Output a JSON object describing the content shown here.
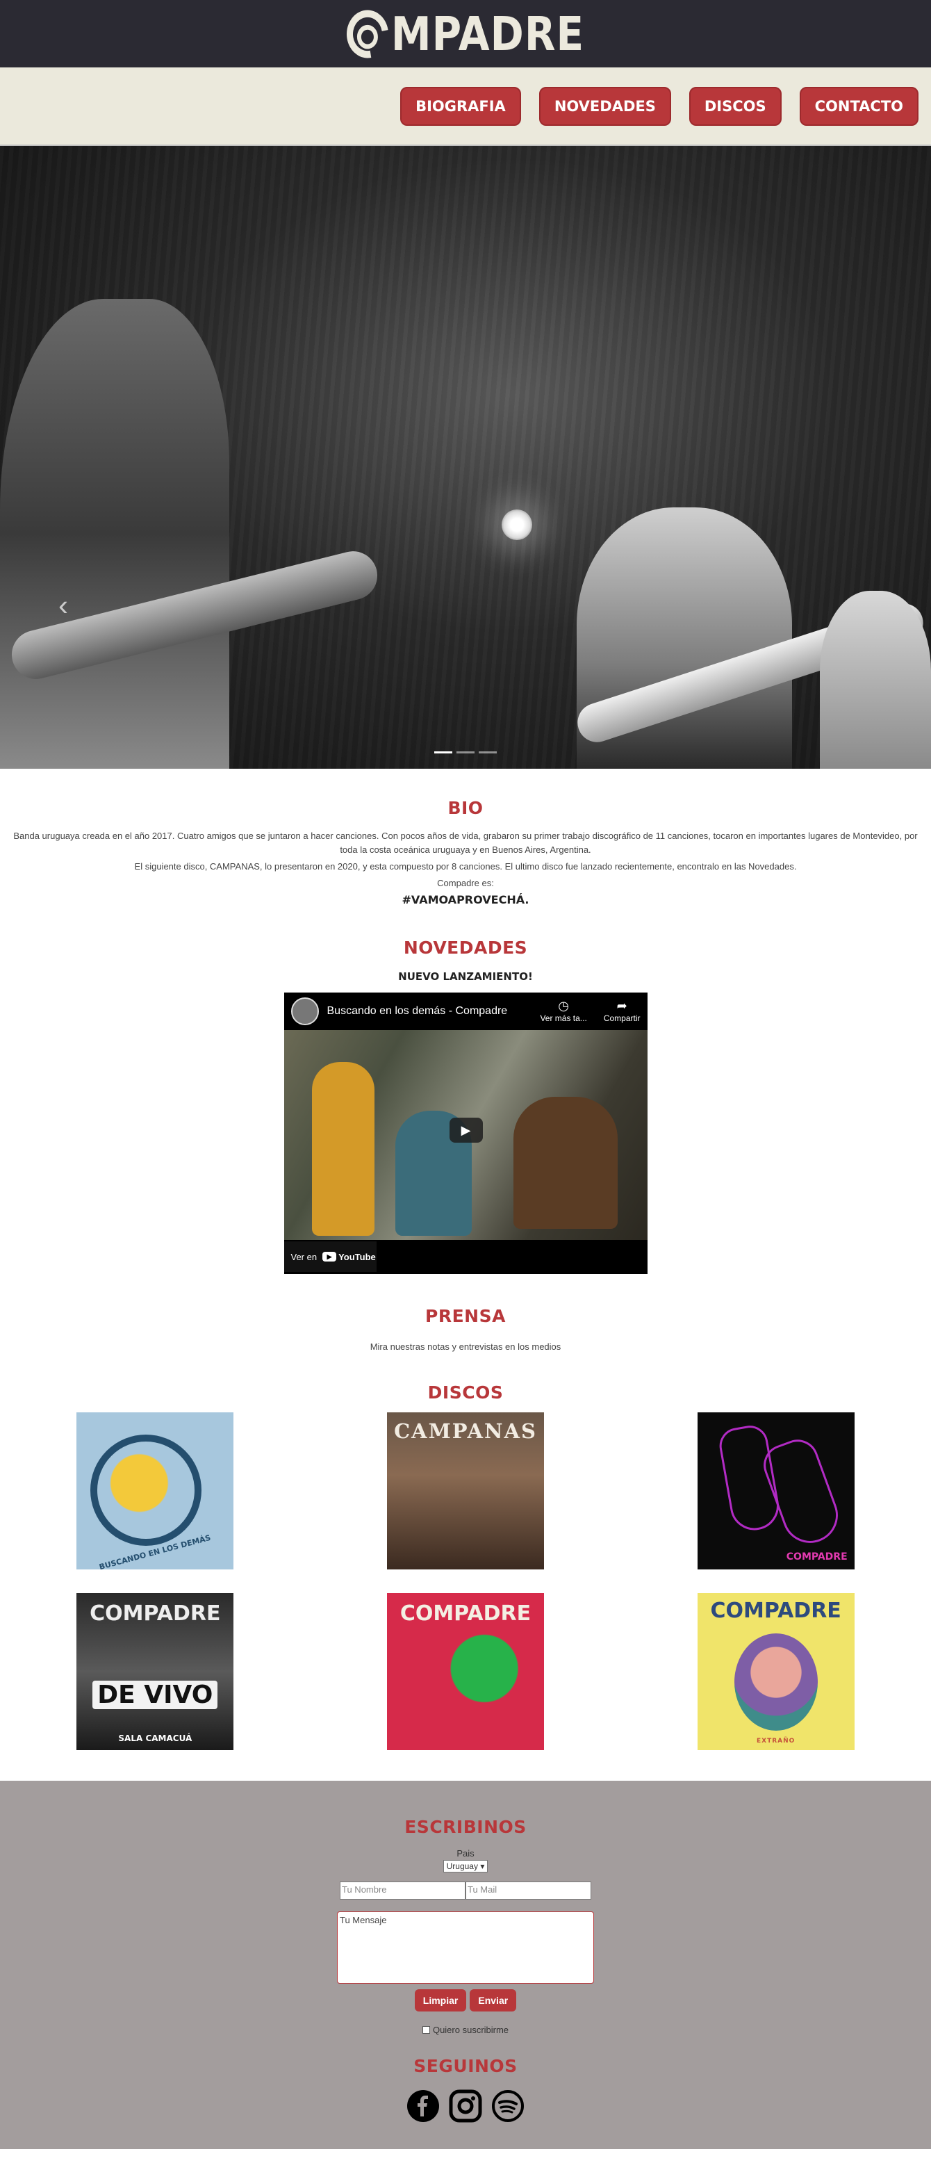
{
  "brand": {
    "logo_text": "MPADRE"
  },
  "nav": {
    "items": [
      {
        "label": "BIOGRAFIA"
      },
      {
        "label": "NOVEDADES"
      },
      {
        "label": "DISCOS"
      },
      {
        "label": "CONTACTO"
      }
    ]
  },
  "hero": {
    "prev_icon": "chevron-left",
    "slide_count": 3,
    "active_slide": 1
  },
  "bio": {
    "title": "BIO",
    "p1": "Banda uruguaya creada en el año 2017. Cuatro amigos que se juntaron a hacer canciones. Con pocos años de vida, grabaron su primer trabajo discográfico de 11 canciones, tocaron en importantes lugares de Montevideo, por toda la costa oceánica uruguaya y en Buenos Aires, Argentina.",
    "p2": "El siguiente disco, CAMPANAS, lo presentaron en 2020, y esta compuesto por 8 canciones. El ultimo disco fue lanzado recientemente, encontralo en las Novedades.",
    "p3": "Compadre es:",
    "tag": "#VAMOAPROVECHÁ."
  },
  "novedades": {
    "title": "NOVEDADES",
    "subtitle": "NUEVO LANZAMIENTO!",
    "video": {
      "title": "Buscando en los demás - Compadre",
      "watch_later": "Ver más ta...",
      "share": "Compartir",
      "watch_on": "Ver en",
      "platform": "YouTube"
    }
  },
  "prensa": {
    "title": "PRENSA",
    "text": "Mira nuestras notas y entrevistas en los medios"
  },
  "discos": {
    "title": "DISCOS",
    "covers": [
      {
        "text": "BUSCANDO EN LOS DEMÁS"
      },
      {
        "text": "CAMPANAS"
      },
      {
        "text": "COMPADRE"
      },
      {
        "t1": "COMPADRE",
        "t2": "DE VIVO",
        "t3": "SALA CAMACUÁ"
      },
      {
        "t1": "COMPADRE"
      },
      {
        "t1": "COMPADRE",
        "t2": "EXTRAÑO"
      }
    ]
  },
  "contact": {
    "title": "ESCRIBINOS",
    "country_label": "Pais",
    "country_value": "Uruguay",
    "name_placeholder": "Tu Nombre",
    "mail_placeholder": "Tu Mail",
    "message_placeholder": "Tu Mensaje",
    "clear_label": "Limpiar",
    "send_label": "Enviar",
    "subscribe_label": "Quiero suscribirme",
    "follow_title": "SEGUINOS"
  },
  "colors": {
    "accent": "#b8373a",
    "header_bg": "#2b2a33",
    "nav_bg": "#ebe9dc",
    "footer_bg": "#a39d9d"
  }
}
